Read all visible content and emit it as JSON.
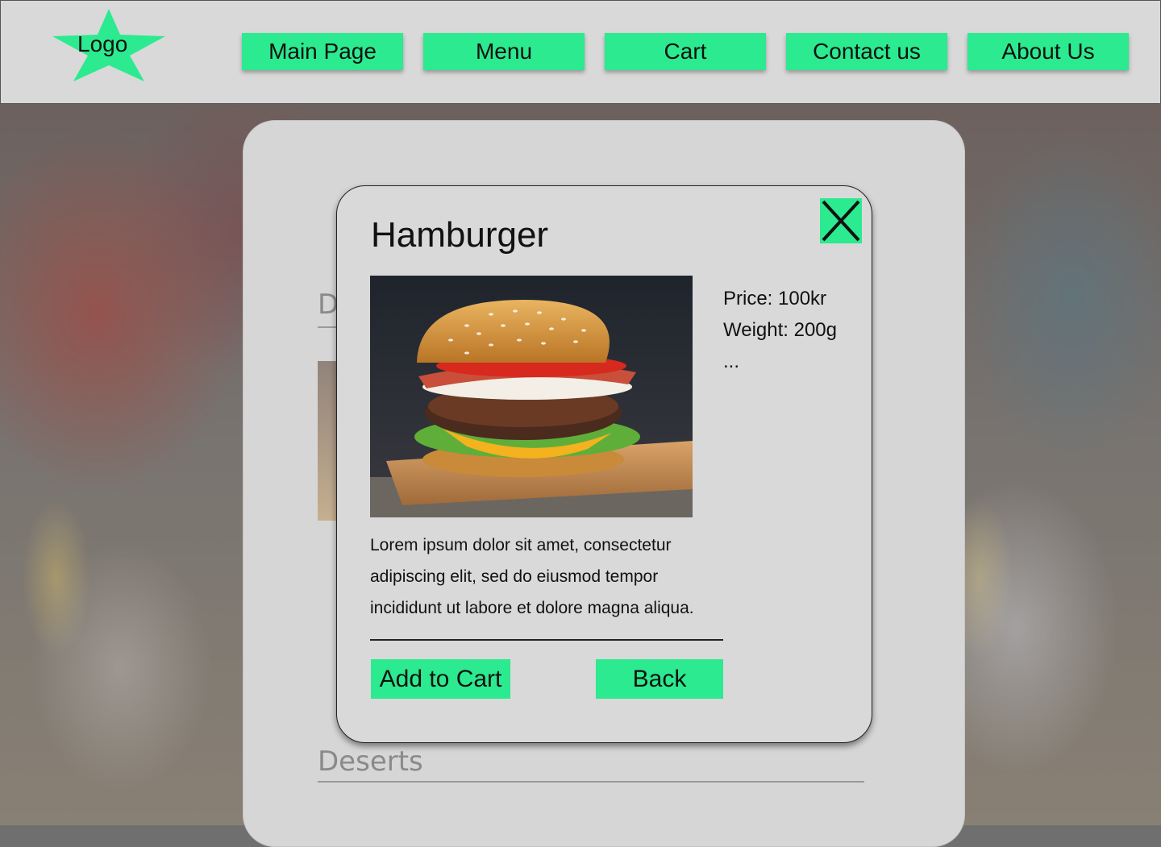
{
  "header": {
    "logo_text": "Logo",
    "nav": [
      {
        "label": "Main Page"
      },
      {
        "label": "Menu"
      },
      {
        "label": "Cart"
      },
      {
        "label": "Contact us"
      },
      {
        "label": "About Us"
      }
    ]
  },
  "menu_panel": {
    "categories": [
      {
        "label": "Dri"
      },
      {
        "label": "Deserts"
      }
    ]
  },
  "dialog": {
    "title": "Hamburger",
    "price": "Price: 100kr",
    "weight": "Weight: 200g",
    "more": "...",
    "description_lines": [
      "Lorem ipsum dolor sit amet, consectetur",
      "adipiscing elit, sed do eiusmod tempor",
      "incididunt ut labore et dolore magna aliqua."
    ],
    "add_to_cart_label": "Add to Cart",
    "back_label": "Back"
  },
  "colors": {
    "accent": "#2bea8f",
    "header_bg": "#d9d9d9",
    "panel_bg": "#d6d6d6",
    "text": "#111111"
  },
  "icons": {
    "logo": "star-icon",
    "close": "close-icon"
  }
}
